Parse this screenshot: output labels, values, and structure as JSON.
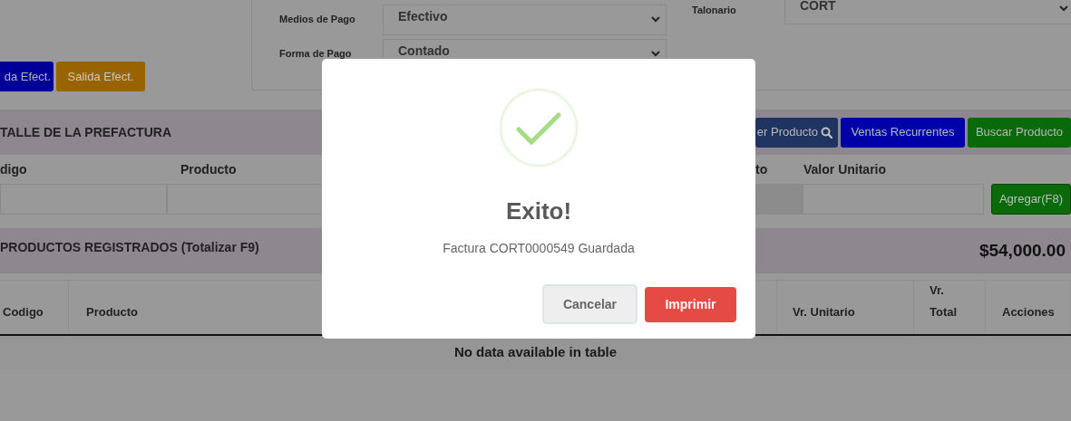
{
  "cash_buttons": [
    {
      "label": "da Efect."
    },
    {
      "label": "Salida Efect."
    }
  ],
  "form": {
    "fields": [
      {
        "label": "Medios de Pago",
        "value": "Efectivo"
      },
      {
        "label": "Forma de Pago",
        "value": "Contado"
      }
    ],
    "talonario": {
      "label": "Talonario",
      "value": "CORT"
    }
  },
  "detail": {
    "title": "TALLE DE LA PREFACTURA",
    "buttons": [
      {
        "label": "er Producto",
        "kind": "search"
      },
      {
        "label": "Ventas Recurrentes",
        "kind": "plain"
      },
      {
        "label": "Buscar Producto",
        "kind": "plain"
      }
    ],
    "labels": [
      "digo",
      "Producto",
      "to",
      "Valor Unitario"
    ],
    "add_button": "Agregar(F8)"
  },
  "registered": {
    "title": "PRODUCTOS REGISTRADOS (Totalizar F9)",
    "total": "$54,000.00"
  },
  "table": {
    "columns": [
      "Codigo",
      "Producto",
      "Vr. Unitario",
      "Vr. Total",
      "Acciones"
    ],
    "empty_message": "No data available in table"
  },
  "dialog": {
    "title": "Exito!",
    "message": "Factura CORT0000549 Guardada",
    "buttons": [
      "Cancelar",
      "Imprimir"
    ]
  }
}
